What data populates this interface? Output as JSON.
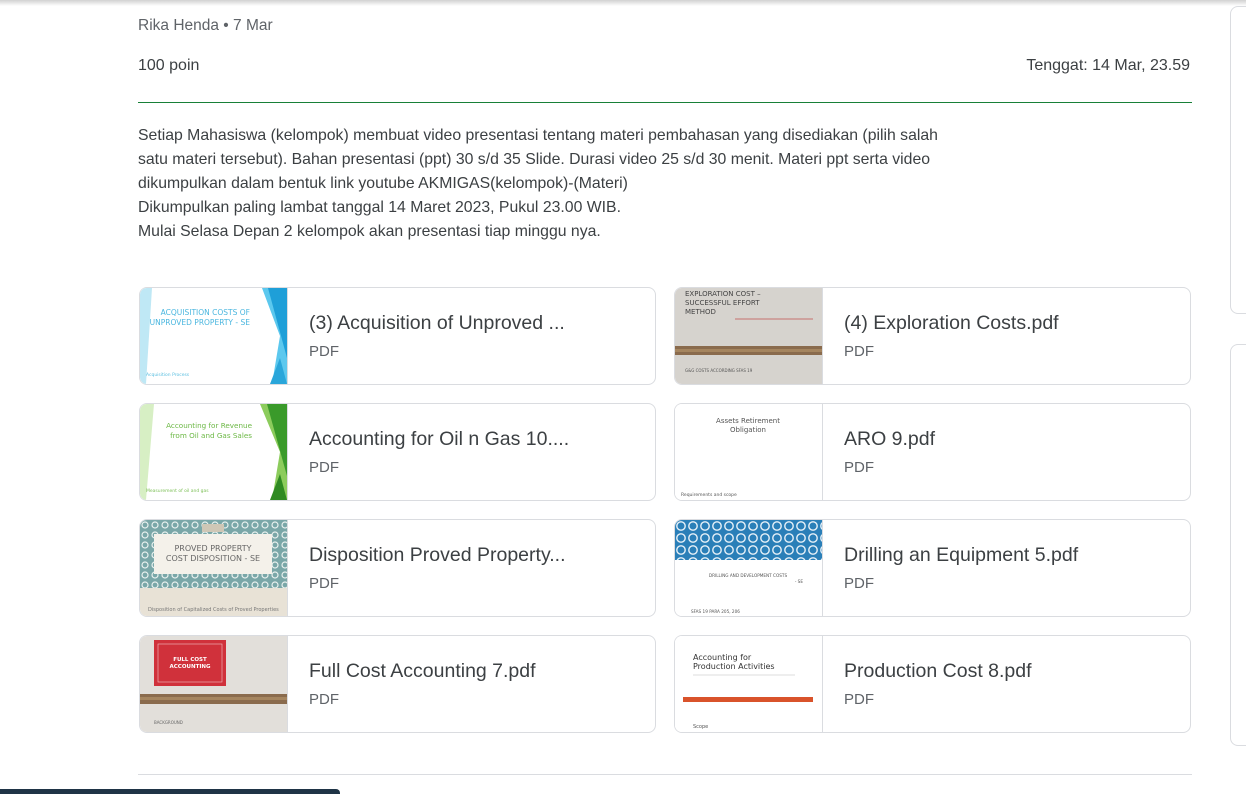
{
  "post": {
    "meta": "Rika Henda • 7 Mar",
    "points": "100 poin",
    "due": "Tenggat: 14 Mar, 23.59",
    "description_lines": [
      "Setiap Mahasiswa (kelompok) membuat video presentasi tentang materi pembahasan yang disediakan (pilih salah",
      "satu materi tersebut). Bahan presentasi (ppt) 30 s/d 35 Slide. Durasi video 25 s/d 30 menit. Materi ppt serta video",
      "dikumpulkan dalam bentuk link youtube AKMIGAS(kelompok)-(Materi)",
      "Dikumpulkan paling lambat tanggal 14 Maret 2023, Pukul 23.00 WIB.",
      "Mulai Selasa Depan 2 kelompok akan presentasi tiap minggu nya."
    ]
  },
  "attachments": [
    {
      "title": "(3) Acquisition of Unproved ...",
      "type": "PDF",
      "thumb_lines": [
        "ACQUISITION COSTS OF",
        "UNPROVED PROPERTY - SE"
      ],
      "thumb_footer": "Acquisition Process"
    },
    {
      "title": "(4) Exploration Costs.pdf",
      "type": "PDF",
      "thumb_lines": [
        "EXPLORATION COST –",
        "SUCCESSFUL EFFORT",
        "METHOD"
      ],
      "thumb_footer": "G&G COSTS ACCORDING SFAS 19"
    },
    {
      "title": "Accounting for Oil n Gas 10....",
      "type": "PDF",
      "thumb_lines": [
        "Accounting for Revenue",
        "from Oil and Gas Sales"
      ],
      "thumb_footer": "Measurement of oil and gas"
    },
    {
      "title": "ARO 9.pdf",
      "type": "PDF",
      "thumb_lines": [
        "Assets Retirement",
        "Obligation"
      ],
      "thumb_footer": "Requirements and scope"
    },
    {
      "title": "Disposition Proved Property...",
      "type": "PDF",
      "thumb_lines": [
        "PROVED PROPERTY",
        "COST DISPOSITION - SE"
      ],
      "thumb_footer": "Disposition of Capitalized Costs of Proved Properties"
    },
    {
      "title": "Drilling an Equipment 5.pdf",
      "type": "PDF",
      "thumb_lines": [
        "DRILLING AND DEVELOPMENT COSTS",
        "- SE"
      ],
      "thumb_footer": "SFAS 19 PARA 205, 206"
    },
    {
      "title": "Full Cost Accounting 7.pdf",
      "type": "PDF",
      "thumb_lines": [
        "FULL COST",
        "ACCOUNTING"
      ],
      "thumb_footer": "BACKGROUND"
    },
    {
      "title": "Production Cost 8.pdf",
      "type": "PDF",
      "thumb_lines": [
        "Accounting for",
        "Production Activities"
      ],
      "thumb_footer": "Scope"
    }
  ],
  "colors": {
    "accent_green": "#188038",
    "border": "#dadce0",
    "text": "#3c4043",
    "muted": "#5f6368"
  }
}
